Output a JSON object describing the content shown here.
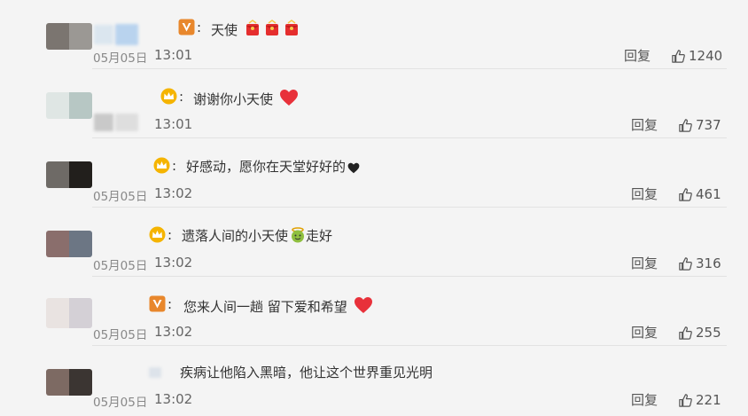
{
  "colors": {
    "background": "#f4f4f4",
    "vip_badge": "#e8872c",
    "crown_badge": "#f5b400",
    "heart_red": "#e8313a",
    "heart_black": "#222222"
  },
  "reply_label": "回复",
  "comments": [
    {
      "badge_icon": "vip-v-badge-icon",
      "text": "天使",
      "emojis": [
        "red-envelope-emoji",
        "red-envelope-emoji",
        "red-envelope-emoji"
      ],
      "date_prefix": "05月05日",
      "time": "13:01",
      "likes": "1240"
    },
    {
      "badge_icon": "crown-badge-icon",
      "text": "谢谢你小天使",
      "emojis": [
        "red-heart-emoji"
      ],
      "date_prefix": "",
      "time": "13:01",
      "likes": "737"
    },
    {
      "badge_icon": "crown-badge-icon",
      "text": "好感动，愿你在天堂好好的",
      "emojis": [
        "black-heart-emoji"
      ],
      "date_prefix": "05月05日",
      "time": "13:02",
      "likes": "461"
    },
    {
      "badge_icon": "crown-badge-icon",
      "text": "遗落人间的小天使",
      "text_after": "走好",
      "emojis": [
        "angel-face-emoji"
      ],
      "date_prefix": "05月05日",
      "time": "13:02",
      "likes": "316"
    },
    {
      "badge_icon": "vip-v-badge-icon",
      "text": "您来人间一趟 留下爱和希望",
      "emojis": [
        "red-heart-emoji"
      ],
      "date_prefix": "05月05日",
      "time": "13:02",
      "likes": "255"
    },
    {
      "badge_icon": "",
      "text": "疾病让他陷入黑暗，他让这个世界重见光明",
      "emojis": [],
      "date_prefix": "05月05日",
      "time": "13:02",
      "likes": "221"
    }
  ]
}
